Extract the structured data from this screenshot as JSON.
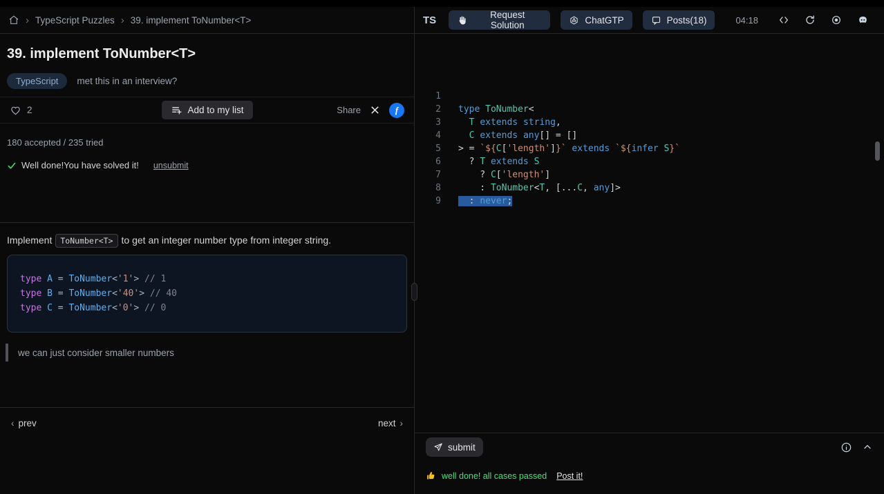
{
  "left": {
    "breadcrumb": {
      "separator": "›",
      "items": [
        "TypeScript Puzzles",
        "39. implement ToNumber<T>"
      ]
    },
    "title": "39. implement ToNumber<T>",
    "tag": "TypeScript",
    "interview_note": "met this in an interview?",
    "like_count": "2",
    "add_to_list_label": "Add to my list",
    "share_label": "Share",
    "facebook_letter": "f",
    "stats": "180 accepted / 235 tried",
    "solved_text": "Well done!You have solved it!",
    "unsubmit_label": "unsubmit",
    "desc_pre": "Implement",
    "desc_code": "ToNumber<T>",
    "desc_post": "to get an integer number type from integer string.",
    "example_lines": [
      {
        "tokens": [
          [
            "type",
            "lkw"
          ],
          [
            " ",
            "lpl"
          ],
          [
            "A",
            "lid"
          ],
          [
            " = ",
            "lpl"
          ],
          [
            "ToNumber",
            "lid"
          ],
          [
            "<",
            "lpl"
          ],
          [
            "'1'",
            "lstr"
          ],
          [
            ">",
            "lpl"
          ],
          [
            " ",
            "lpl"
          ],
          [
            "// 1",
            "lcm"
          ]
        ]
      },
      {
        "tokens": [
          [
            "type",
            "lkw"
          ],
          [
            " ",
            "lpl"
          ],
          [
            "B",
            "lid"
          ],
          [
            " = ",
            "lpl"
          ],
          [
            "ToNumber",
            "lid"
          ],
          [
            "<",
            "lpl"
          ],
          [
            "'40'",
            "lstr"
          ],
          [
            ">",
            "lpl"
          ],
          [
            " ",
            "lpl"
          ],
          [
            "// 40",
            "lcm"
          ]
        ]
      },
      {
        "tokens": [
          [
            "type",
            "lkw"
          ],
          [
            " ",
            "lpl"
          ],
          [
            "C",
            "lid"
          ],
          [
            " = ",
            "lpl"
          ],
          [
            "ToNumber",
            "lid"
          ],
          [
            "<",
            "lpl"
          ],
          [
            "'0'",
            "lstr"
          ],
          [
            ">",
            "lpl"
          ],
          [
            " ",
            "lpl"
          ],
          [
            "// 0",
            "lcm"
          ]
        ]
      }
    ],
    "quote": "we can just consider smaller numbers",
    "prev_chevron": "‹",
    "prev_label": "prev",
    "next_label": "next",
    "next_chevron": "›"
  },
  "editor": {
    "logo": "TS",
    "request_solution_label": "Request Solution",
    "chatgtp_label": "ChatGTP",
    "posts_label": "Posts(18)",
    "time": "04:18",
    "code_lines": [
      {
        "num": "1",
        "tokens": []
      },
      {
        "num": "2",
        "tokens": [
          [
            "type",
            "kw"
          ],
          [
            " ",
            "pl"
          ],
          [
            "ToNumber",
            "ty"
          ],
          [
            "<",
            "pl"
          ]
        ]
      },
      {
        "num": "3",
        "tokens": [
          [
            "  ",
            "pl"
          ],
          [
            "T",
            "ty"
          ],
          [
            " ",
            "pl"
          ],
          [
            "extends",
            "kw"
          ],
          [
            " ",
            "pl"
          ],
          [
            "string",
            "kw"
          ],
          [
            ",",
            "pl"
          ]
        ]
      },
      {
        "num": "4",
        "tokens": [
          [
            "  ",
            "pl"
          ],
          [
            "C",
            "ty"
          ],
          [
            " ",
            "pl"
          ],
          [
            "extends",
            "kw"
          ],
          [
            " ",
            "pl"
          ],
          [
            "any",
            "kw"
          ],
          [
            "[] = []",
            "pl"
          ]
        ]
      },
      {
        "num": "5",
        "tokens": [
          [
            "> = ",
            "pl"
          ],
          [
            "`${",
            "str"
          ],
          [
            "C",
            "ty"
          ],
          [
            "[",
            "pl"
          ],
          [
            "'length'",
            "str"
          ],
          [
            "]",
            "pl"
          ],
          [
            "}`",
            "str"
          ],
          [
            " ",
            "pl"
          ],
          [
            "extends",
            "kw"
          ],
          [
            " ",
            "pl"
          ],
          [
            "`${",
            "str"
          ],
          [
            "infer",
            "kw"
          ],
          [
            " ",
            "pl"
          ],
          [
            "S",
            "ty"
          ],
          [
            "}`",
            "str"
          ]
        ]
      },
      {
        "num": "6",
        "tokens": [
          [
            "  ? ",
            "pl"
          ],
          [
            "T",
            "ty"
          ],
          [
            " ",
            "pl"
          ],
          [
            "extends",
            "kw"
          ],
          [
            " ",
            "pl"
          ],
          [
            "S",
            "ty"
          ]
        ]
      },
      {
        "num": "7",
        "tokens": [
          [
            "    ? ",
            "pl"
          ],
          [
            "C",
            "ty"
          ],
          [
            "[",
            "pl"
          ],
          [
            "'length'",
            "str"
          ],
          [
            "]",
            "pl"
          ]
        ]
      },
      {
        "num": "8",
        "tokens": [
          [
            "    : ",
            "pl"
          ],
          [
            "ToNumber",
            "ty"
          ],
          [
            "<",
            "pl"
          ],
          [
            "T",
            "ty"
          ],
          [
            ", [...",
            "pl"
          ],
          [
            "C",
            "ty"
          ],
          [
            ", ",
            "pl"
          ],
          [
            "any",
            "kw"
          ],
          [
            "]>",
            "pl"
          ]
        ]
      },
      {
        "num": "9",
        "sel": true,
        "tokens": [
          [
            "  : ",
            "pl"
          ],
          [
            "never",
            "kw"
          ],
          [
            ";",
            "pl"
          ]
        ]
      }
    ],
    "submit_label": "submit",
    "status_text": "well done! all cases passed",
    "post_link": "Post it!"
  },
  "icons": {
    "home-icon": "svg-house",
    "heart-icon": "svg-heart-outline",
    "playlist-add-icon": "svg-lines-plus",
    "x-logo-icon": "svg-x-cross",
    "facebook-icon": "blue-circle-f",
    "check-icon": "svg-green-check",
    "hand-icon": "svg-raised-hand",
    "openai-icon": "svg-hexagon-knot",
    "posts-icon": "svg-chat-bubble",
    "code-icon": "svg-angle-brackets",
    "refresh-icon": "svg-circular-arrow",
    "record-icon": "svg-dot-in-circle",
    "discord-icon": "svg-discord-face",
    "send-icon": "svg-paper-plane",
    "info-icon": "svg-info-circle",
    "chevron-up-icon": "svg-chevron-up",
    "thumbs-up-icon": "svg-yellow-thumb"
  },
  "colors": {
    "facebook": "#1877f2",
    "success": "#4ade80",
    "selection": "#2a5a9e",
    "accent_button": "#212c3e"
  }
}
